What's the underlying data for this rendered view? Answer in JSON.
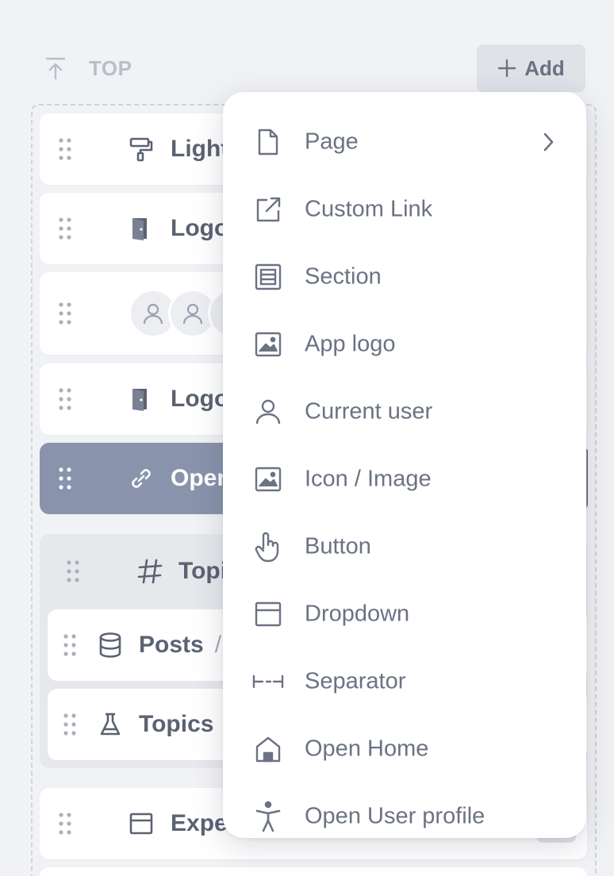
{
  "header": {
    "section_label": "TOP",
    "add_label": "Add"
  },
  "rows": [
    {
      "label": "Light/da",
      "icon": "paint-roller-icon"
    },
    {
      "label": "Logout",
      "icon": "door-icon"
    },
    {
      "label": "",
      "icon": "avatars"
    },
    {
      "label": "Logout",
      "icon": "door-icon"
    },
    {
      "label": "Open wo",
      "icon": "link-icon"
    }
  ],
  "group": {
    "label": "Topics",
    "icon": "hash-icon",
    "children": [
      {
        "label": "Posts",
        "suffix": "/",
        "icon": "database-icon"
      },
      {
        "label": "Topics",
        "icon": "flask-icon"
      }
    ]
  },
  "after_group": {
    "label": "Experts",
    "icon": "dropdown-box-icon"
  },
  "menu": {
    "items": [
      {
        "label": "Page",
        "icon": "file-icon",
        "has_submenu": true
      },
      {
        "label": "Custom Link",
        "icon": "external-link-icon"
      },
      {
        "label": "Section",
        "icon": "section-icon"
      },
      {
        "label": "App logo",
        "icon": "image-icon"
      },
      {
        "label": "Current user",
        "icon": "user-icon"
      },
      {
        "label": "Icon / Image",
        "icon": "image-icon"
      },
      {
        "label": "Button",
        "icon": "pointer-hand-icon"
      },
      {
        "label": "Dropdown",
        "icon": "dropdown-icon"
      },
      {
        "label": "Separator",
        "icon": "separator-icon"
      },
      {
        "label": "Open Home",
        "icon": "home-icon"
      },
      {
        "label": "Open User profile",
        "icon": "accessibility-icon"
      }
    ]
  },
  "colors": {
    "background": "#f1f2f5",
    "selected_row": "#8993ab",
    "text": "#5b6272",
    "menu_text": "#6b7283"
  }
}
